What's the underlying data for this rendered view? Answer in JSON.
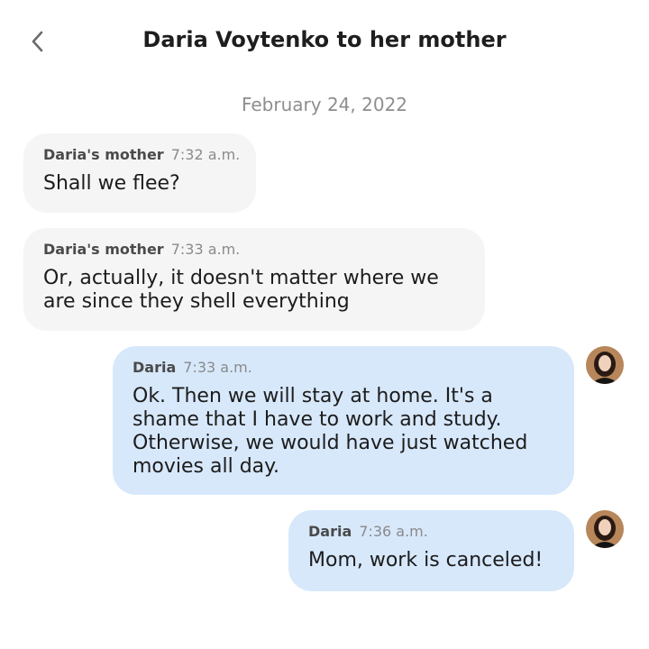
{
  "header": {
    "title": "Daria Voytenko to her mother"
  },
  "date_separator": "February 24, 2022",
  "messages": [
    {
      "sender": "Daria's mother",
      "time": "7:32 a.m.",
      "text": "Shall we flee?",
      "direction": "incoming"
    },
    {
      "sender": "Daria's mother",
      "time": "7:33 a.m.",
      "text": "Or, actually, it doesn't matter where we are since they shell everything",
      "direction": "incoming"
    },
    {
      "sender": "Daria",
      "time": "7:33 a.m.",
      "text": "Ok. Then we will stay at home. It's a shame that I have to work and study. Otherwise, we would have just watched movies all day.",
      "direction": "outgoing"
    },
    {
      "sender": "Daria",
      "time": "7:36 a.m.",
      "text": "Mom, work is canceled!",
      "direction": "outgoing"
    }
  ],
  "colors": {
    "incoming_bubble": "#f5f5f5",
    "outgoing_bubble": "#d7e8fb",
    "date_text": "#8e8e8e"
  },
  "icons": {
    "back": "chevron-left-icon",
    "avatar": "avatar"
  }
}
